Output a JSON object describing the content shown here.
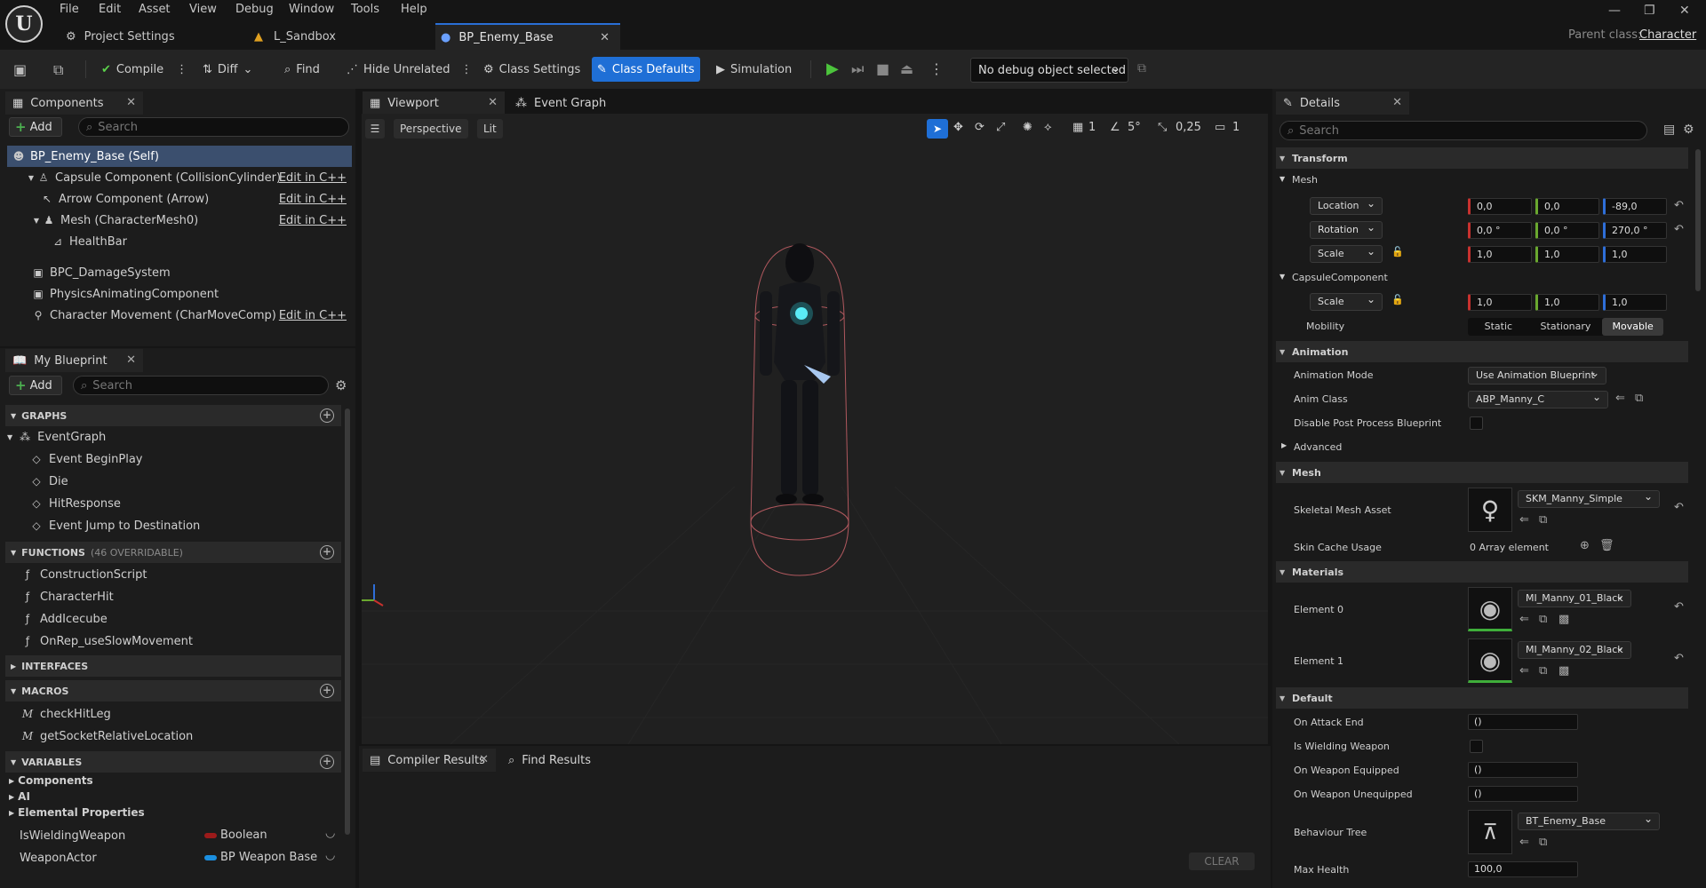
{
  "menu": [
    "File",
    "Edit",
    "Asset",
    "View",
    "Debug",
    "Window",
    "Tools",
    "Help"
  ],
  "logo_text": "U",
  "window_controls": [
    "—",
    "❐",
    "✕"
  ],
  "tabs": {
    "project_settings": "Project Settings",
    "sandbox": "L_Sandbox",
    "blueprint": "BP_Enemy_Base",
    "parent_class_label": "Parent class:",
    "parent_class_value": "Character"
  },
  "toolbar": {
    "compile": "Compile",
    "diff": "Diff",
    "find": "Find",
    "hide_unrelated": "Hide Unrelated",
    "class_settings": "Class Settings",
    "class_defaults": "Class Defaults",
    "simulation": "Simulation",
    "debug_object": "No debug object selected"
  },
  "components": {
    "tab": "Components",
    "add": "Add",
    "search_placeholder": "Search",
    "self": "BP_Enemy_Base (Self)",
    "items": [
      {
        "label": "Capsule Component (CollisionCylinder)",
        "edit": "Edit in C++"
      },
      {
        "label": "Arrow Component (Arrow)",
        "edit": "Edit in C++"
      },
      {
        "label": "Mesh (CharacterMesh0)",
        "edit": "Edit in C++"
      },
      {
        "label": "HealthBar",
        "edit": ""
      },
      {
        "label": "BPC_DamageSystem",
        "edit": ""
      },
      {
        "label": "PhysicsAnimatingComponent",
        "edit": ""
      },
      {
        "label": "Character Movement (CharMoveComp)",
        "edit": "Edit in C++"
      }
    ]
  },
  "my_blueprint": {
    "tab": "My Blueprint",
    "add": "Add",
    "search_placeholder": "Search",
    "graphs_header": "GRAPHS",
    "event_graph": "EventGraph",
    "events": [
      "Event BeginPlay",
      "Die",
      "HitResponse",
      "Event Jump to Destination"
    ],
    "functions_header": "FUNCTIONS",
    "functions_count": "(46 OVERRIDABLE)",
    "functions": [
      "ConstructionScript",
      "CharacterHit",
      "AddIcecube",
      "OnRep_useSlowMovement"
    ],
    "interfaces_header": "INTERFACES",
    "macros_header": "MACROS",
    "macros": [
      "checkHitLeg",
      "getSocketRelativeLocation"
    ],
    "variables_header": "VARIABLES",
    "var_categories": [
      "Components",
      "AI",
      "Elemental Properties"
    ],
    "variables": [
      {
        "name": "IsWieldingWeapon",
        "type": "Boolean",
        "color": "#9b1a1a"
      },
      {
        "name": "WeaponActor",
        "type": "BP Weapon Base",
        "color": "#1b8fe0"
      }
    ]
  },
  "viewport": {
    "tab": "Viewport",
    "event_graph_tab": "Event Graph",
    "perspective": "Perspective",
    "lit": "Lit",
    "grid_value": "1",
    "angle_value": "5°",
    "scale_value": "0,25",
    "camera_value": "1"
  },
  "bottom": {
    "compiler_results": "Compiler Results",
    "find_results": "Find Results",
    "clear": "CLEAR"
  },
  "details": {
    "tab": "Details",
    "search_placeholder": "Search",
    "transform": "Transform",
    "mesh_sub": "Mesh",
    "location_label": "Location",
    "location": [
      "0,0",
      "0,0",
      "-89,0"
    ],
    "rotation_label": "Rotation",
    "rotation": [
      "0,0 °",
      "0,0 °",
      "270,0 °"
    ],
    "scale_label": "Scale",
    "scale": [
      "1,0",
      "1,0",
      "1,0"
    ],
    "capsule_sub": "CapsuleComponent",
    "capsule_scale": [
      "1,0",
      "1,0",
      "1,0"
    ],
    "mobility_label": "Mobility",
    "mobility_options": [
      "Static",
      "Stationary",
      "Movable"
    ],
    "animation": "Animation",
    "anim_mode_label": "Animation Mode",
    "anim_mode_value": "Use Animation Blueprint",
    "anim_class_label": "Anim Class",
    "anim_class_value": "ABP_Manny_C",
    "disable_pp_label": "Disable Post Process Blueprint",
    "advanced": "Advanced",
    "mesh": "Mesh",
    "skeletal_mesh_label": "Skeletal Mesh Asset",
    "skeletal_mesh_value": "SKM_Manny_Simple",
    "skin_cache_label": "Skin Cache Usage",
    "skin_cache_value": "0 Array element",
    "materials": "Materials",
    "element0_label": "Element 0",
    "element0_value": "MI_Manny_01_Black",
    "element1_label": "Element 1",
    "element1_value": "MI_Manny_02_Black",
    "default": "Default",
    "on_attack_end_label": "On Attack End",
    "on_attack_end_value": "()",
    "is_wielding_label": "Is Wielding Weapon",
    "on_weapon_equipped_label": "On Weapon Equipped",
    "on_weapon_equipped_value": "()",
    "on_weapon_unequipped_label": "On Weapon Unequipped",
    "on_weapon_unequipped_value": "()",
    "behaviour_tree_label": "Behaviour Tree",
    "behaviour_tree_value": "BT_Enemy_Base",
    "max_health_label": "Max Health",
    "max_health_value": "100,0"
  }
}
